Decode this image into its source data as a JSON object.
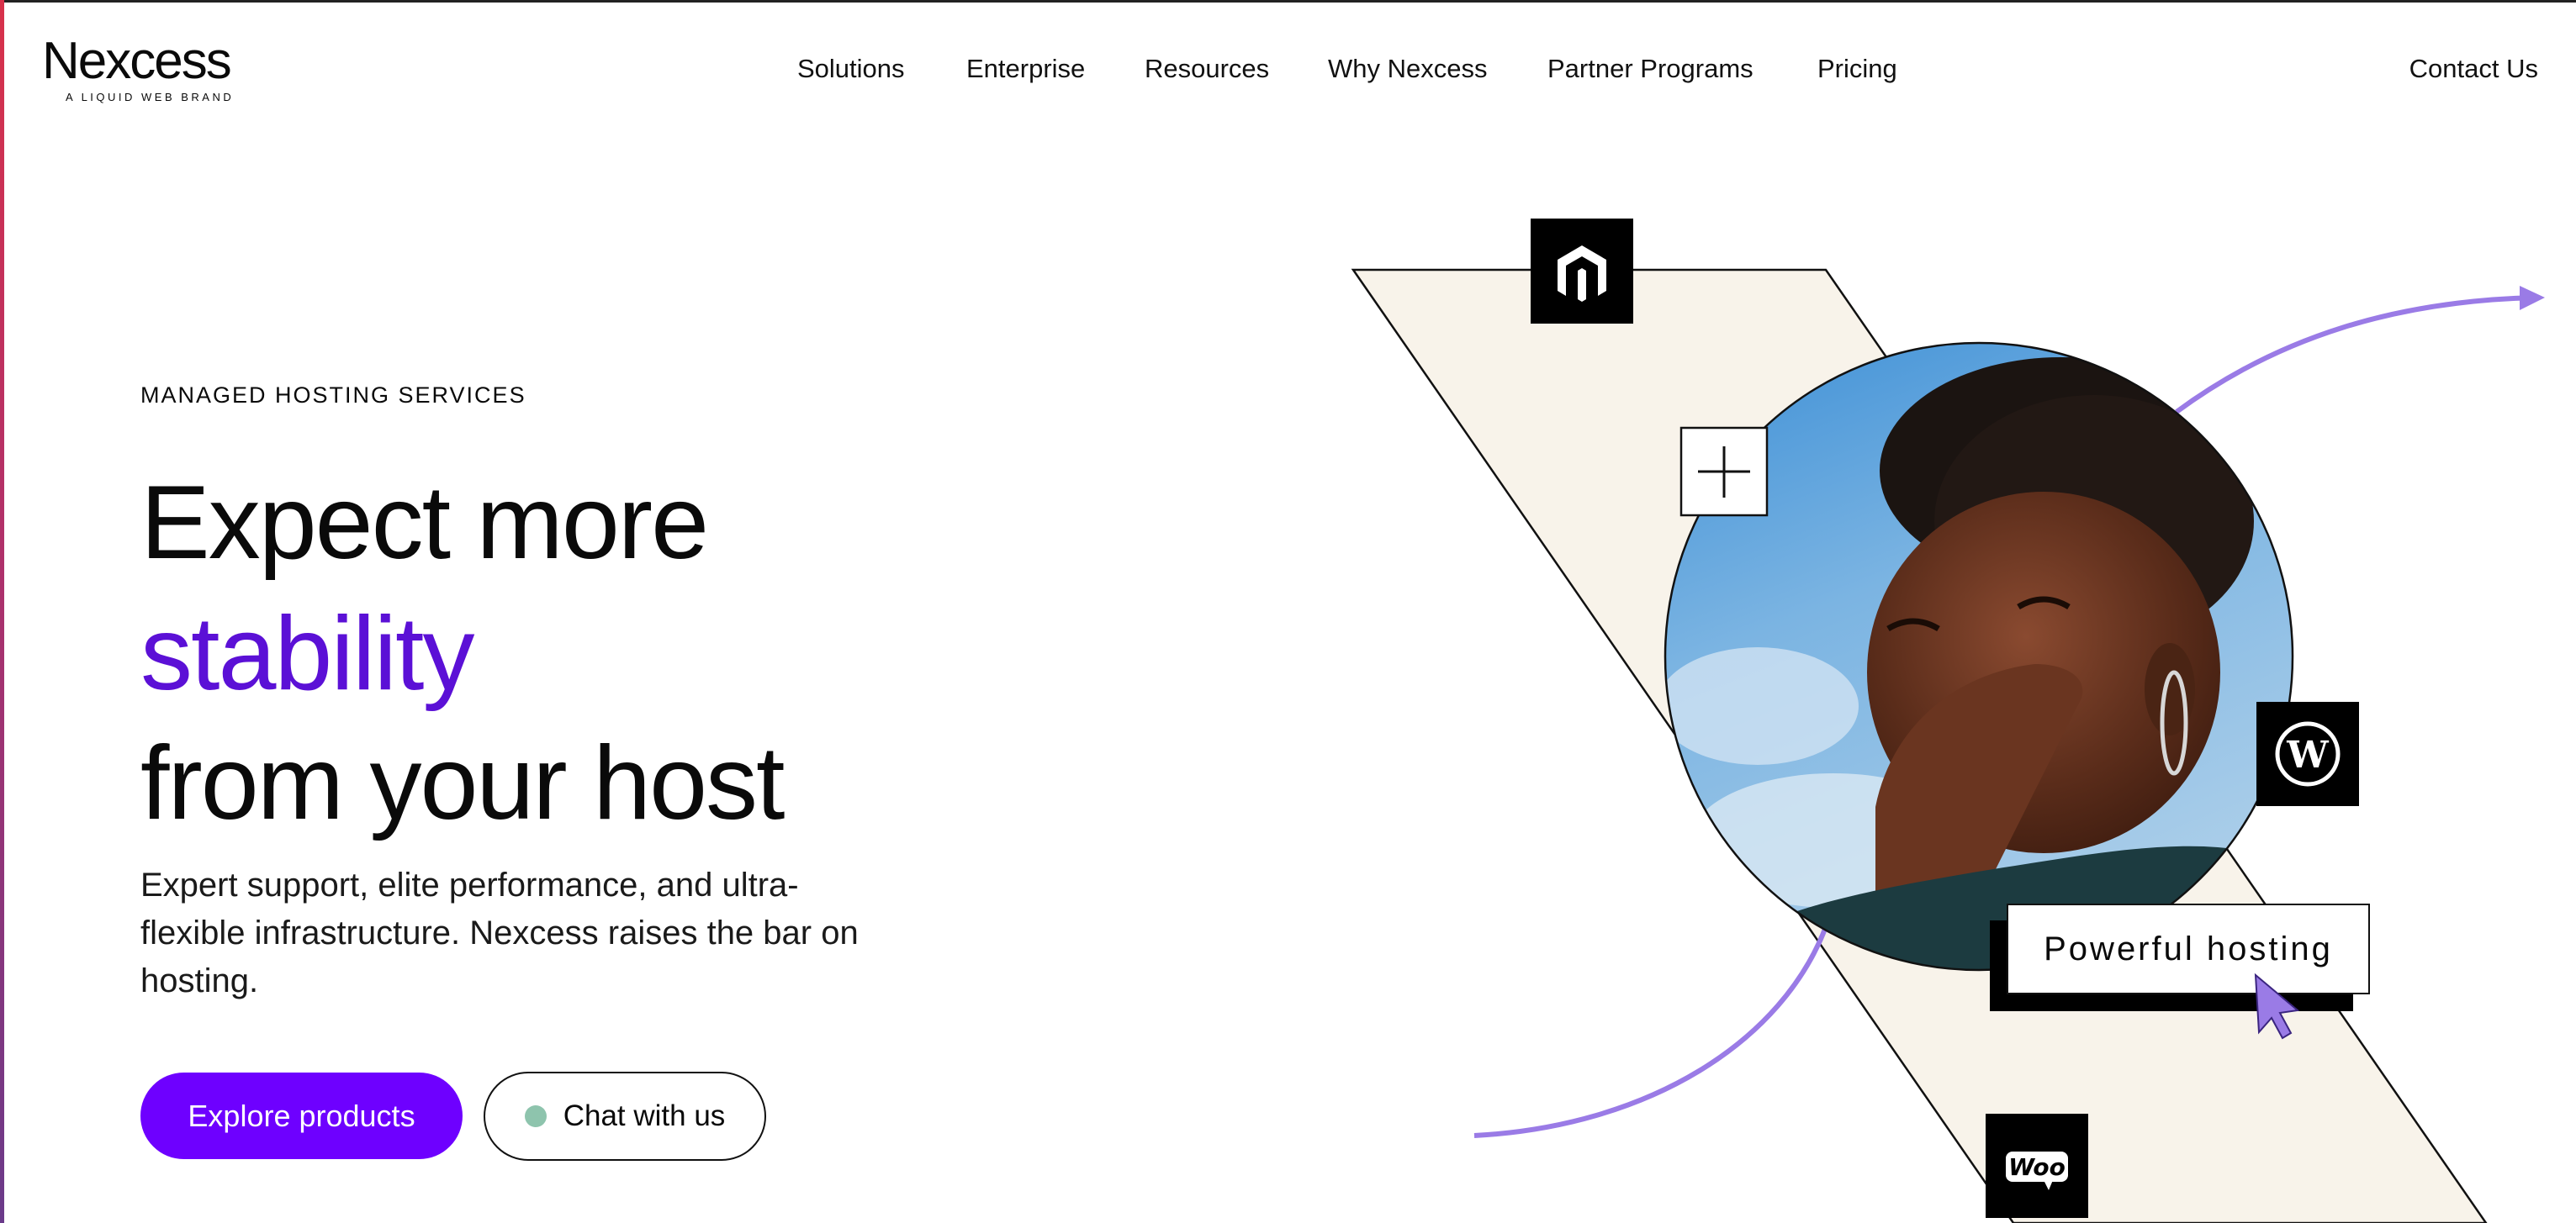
{
  "brand": {
    "name": "Nexcess",
    "tagline": "A LIQUID WEB BRAND"
  },
  "nav": {
    "items": [
      "Solutions",
      "Enterprise",
      "Resources",
      "Why Nexcess",
      "Partner Programs",
      "Pricing"
    ],
    "contact": "Contact Us"
  },
  "hero": {
    "eyebrow": "MANAGED HOSTING SERVICES",
    "headline_1": "Expect more",
    "headline_2": "stability",
    "headline_3": "from your host",
    "lede": "Expert support, elite performance, and ultra-flexible infrastructure. Nexcess raises the bar on hosting.",
    "primary_cta": "Explore products",
    "secondary_cta": "Chat with us"
  },
  "illustration": {
    "callout": "Powerful hosting",
    "icons": [
      "magento-icon",
      "plus-icon",
      "wordpress-icon",
      "woocommerce-icon",
      "cursor-icon"
    ],
    "woo_text": "Woo"
  },
  "colors": {
    "accent": "#6e00ff",
    "headline_accent": "#5b10d6",
    "panel": "#f8f3ea",
    "arc": "#9a7be6",
    "status_dot": "#8ec4ad"
  }
}
